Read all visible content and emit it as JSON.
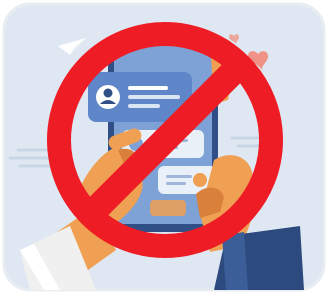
{
  "illustration": {
    "subject": "no-phone-sign-icon",
    "colors": {
      "card_background": "#dfe8f2",
      "phone_body": "#2f4f86",
      "phone_screen": "#7fa2d6",
      "screen_card": "#5e86c8",
      "hand_skin": "#f0a052",
      "hand_shadow": "#d9813a",
      "sleeve_left": "#f0f0f0",
      "sleeve_right": "#2c4a7e",
      "prohibition_red": "#ee1c25",
      "heart": "#f28a7a",
      "paper_plane": "#ffffff"
    }
  }
}
